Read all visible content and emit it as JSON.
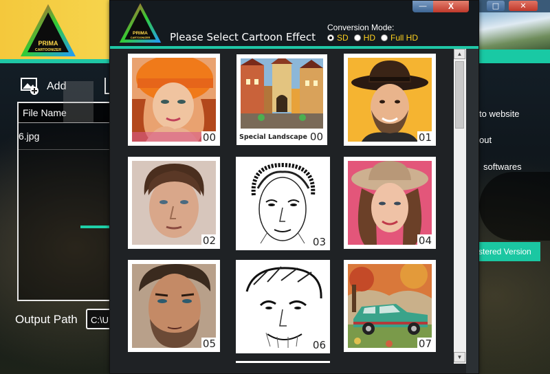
{
  "app": {
    "logo_text": "PRIMA CARTOONIZER"
  },
  "toolbar": {
    "add_label": "Add"
  },
  "file_list": {
    "header": "File Name",
    "rows": [
      "6.jpg"
    ]
  },
  "output": {
    "label": "Output Path",
    "value": "C:\\U"
  },
  "right_panel": {
    "links": [
      "to website",
      "out",
      "softwares"
    ],
    "register_label": "stered Version"
  },
  "dialog": {
    "title": "Please Select Cartoon Effect",
    "controls": {
      "minimize": "—",
      "close": "X"
    },
    "conversion_mode": {
      "label": "Conversion Mode:",
      "options": [
        {
          "label": "SD",
          "selected": true
        },
        {
          "label": "HD",
          "selected": false
        },
        {
          "label": "Full HD",
          "selected": false
        }
      ]
    },
    "effects": [
      {
        "number": "00",
        "caption": "",
        "subject": "girl-orange-beanie"
      },
      {
        "number": "00",
        "caption": "Special Landscape",
        "subject": "old-town-street"
      },
      {
        "number": "01",
        "caption": "",
        "subject": "man-fedora-hat"
      },
      {
        "number": "02",
        "caption": "",
        "subject": "young-man-portrait"
      },
      {
        "number": "03",
        "caption": "",
        "subject": "pencil-sketch-face"
      },
      {
        "number": "04",
        "caption": "",
        "subject": "woman-straw-hat"
      },
      {
        "number": "05",
        "caption": "",
        "subject": "bearded-man-portrait"
      },
      {
        "number": "06",
        "caption": "",
        "subject": "ink-sketch-man"
      },
      {
        "number": "07",
        "caption": "",
        "subject": "vintage-car-painting"
      }
    ]
  },
  "colors": {
    "teal": "#1fc7a6",
    "yellow": "#f6d44c",
    "radio_text": "#ffd21f"
  }
}
